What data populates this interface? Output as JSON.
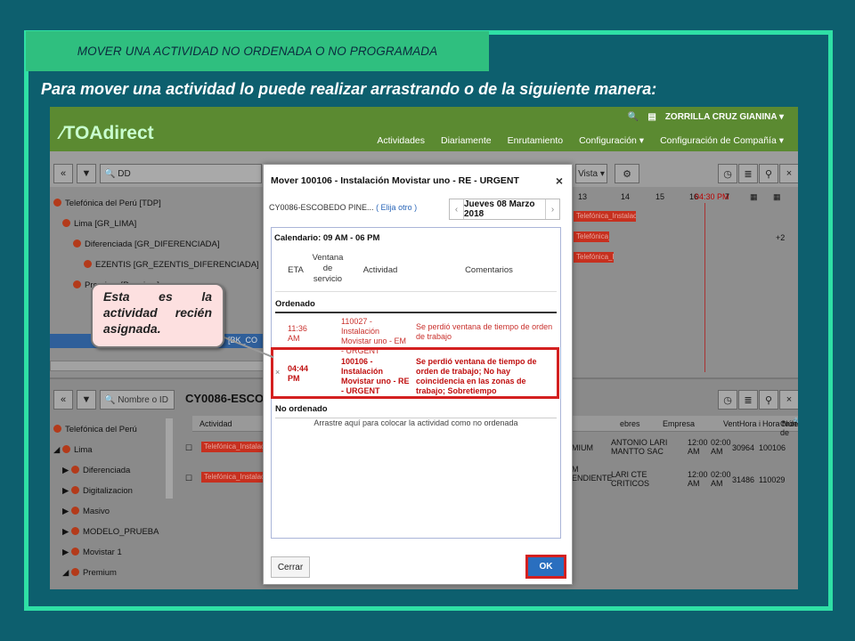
{
  "slide": {
    "title": "MOVER UNA ACTIVIDAD NO ORDENADA O NO PROGRAMADA",
    "instruction": "Para mover una actividad lo puede realizar arrastrando o de la siguiente manera:",
    "callout": "Esta es la actividad recién asignada."
  },
  "app": {
    "logo": "TOAdirect",
    "user": "ZORRILLA CRUZ GIANINA",
    "nav": [
      "Actividades",
      "Diariamente",
      "Enrutamiento",
      "Configuración ▾",
      "Configuración de Compañía ▾"
    ],
    "search_top": "DD",
    "search_bottom_placeholder": "Nombre o ID",
    "view_label": "Vista ▾",
    "timeline": [
      "13",
      "14",
      "15",
      "16",
      "04:30 PM",
      "7"
    ],
    "tree_top": [
      "Telefónica del Perú [TDP]",
      "Lima [GR_LIMA]",
      "Diferenciada [GR_DIFERENCIADA]",
      "EZENTIS [GR_EZENTIS_DIFERENCIADA]",
      "Premium [Premium]"
    ],
    "selected_item": "[BK_CO",
    "count_badge": "+2",
    "bar_label": "Telefónica_Instalación",
    "resource_header": "CY0086-ESCOBE",
    "tree_bottom": [
      "Telefónica del Perú",
      "Lima",
      "Diferenciada",
      "Digitalizacion",
      "Masivo",
      "MODELO_PRUEBA",
      "Movistar 1",
      "Premium"
    ],
    "grid_columns": [
      "Actividad",
      "ebres",
      "Empresa",
      "Vent",
      "Hora i",
      "Hora f",
      "Númer",
      "Orden de"
    ],
    "grid_rows": [
      {
        "segment": "EMIUM",
        "empresa": "ANTONIO LARI MANTTO SAC",
        "hi": "12:00 AM",
        "hf": "02:00 AM",
        "num": "30964",
        "orden": "100106"
      },
      {
        "segment": "EM PENDIENTE",
        "empresa": "LARI CTE CRITICOS",
        "hi": "12:00 AM",
        "hf": "02:00 AM",
        "num": "31486",
        "orden": "110029"
      }
    ]
  },
  "dialog": {
    "title": "Mover 100106 - Instalación Movistar uno - RE - URGENT",
    "resource": "CY0086-ESCOBEDO PINE...",
    "resource_link": "( Elija otro )",
    "date": "Jueves 08 Marzo 2018",
    "calendar": "Calendario: 09 AM - 06 PM",
    "columns": {
      "eta": "ETA",
      "window": "Ventana de servicio",
      "activity": "Actividad",
      "comments": "Comentarios"
    },
    "ordered_label": "Ordenado",
    "rows": [
      {
        "eta": "11:36 AM",
        "activity": "110027 - Instalación Movistar uno - EM - URGENT",
        "comment": "Se perdió ventana de tiempo de orden de trabajo"
      },
      {
        "mark": "×",
        "eta": "04:44 PM",
        "activity": "100106 - Instalación Movistar uno - RE - URGENT",
        "comment": "Se perdió ventana de tiempo de orden de trabajo; No hay coincidencia en las zonas de trabajo; Sobretiempo"
      }
    ],
    "unordered_label": "No ordenado",
    "dropzone": "Arrastre aquí para colocar la actividad como no ordenada",
    "cancel": "Cerrar",
    "ok": "OK"
  }
}
